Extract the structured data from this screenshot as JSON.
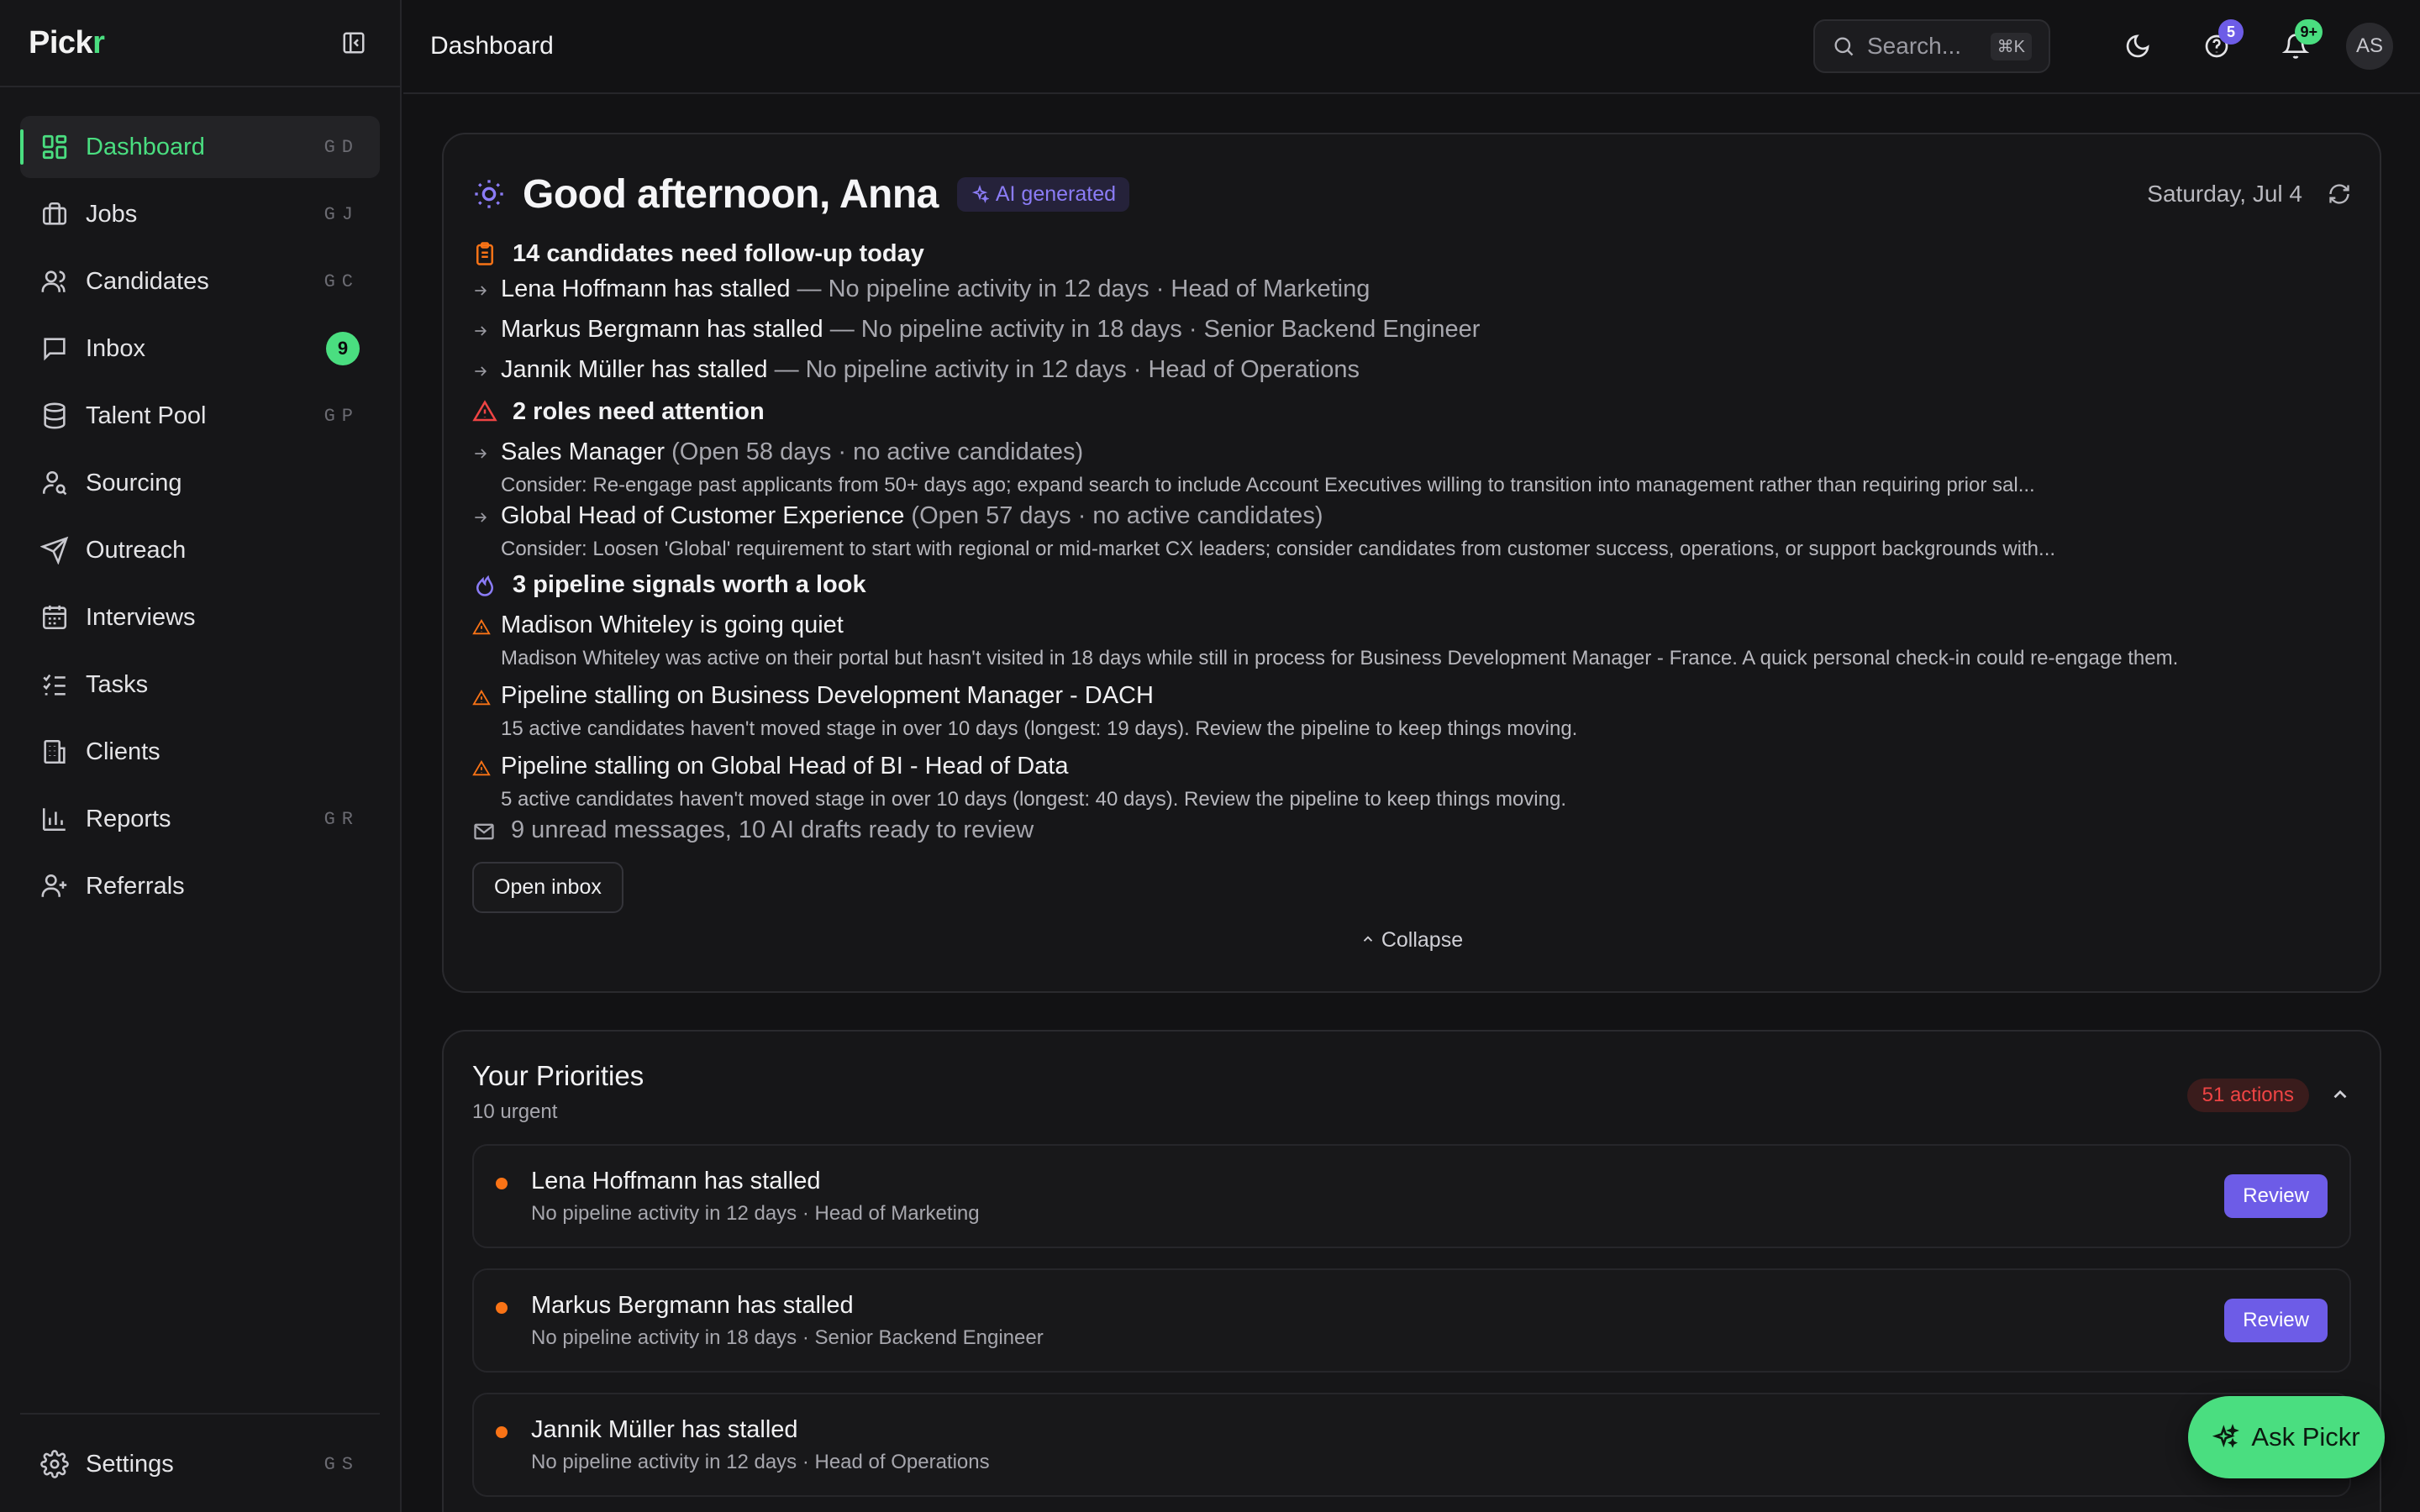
{
  "app": {
    "logo_main": "Pick",
    "logo_accent": "r"
  },
  "sidebar": {
    "items": [
      {
        "label": "Dashboard",
        "shortcut": "GD",
        "icon": "dashboard-icon"
      },
      {
        "label": "Jobs",
        "shortcut": "GJ",
        "icon": "briefcase-icon"
      },
      {
        "label": "Candidates",
        "shortcut": "GC",
        "icon": "users-icon"
      },
      {
        "label": "Inbox",
        "badge": "9",
        "icon": "message-icon"
      },
      {
        "label": "Talent Pool",
        "shortcut": "GP",
        "icon": "database-icon"
      },
      {
        "label": "Sourcing",
        "icon": "user-search-icon"
      },
      {
        "label": "Outreach",
        "icon": "send-icon"
      },
      {
        "label": "Interviews",
        "icon": "calendar-icon"
      },
      {
        "label": "Tasks",
        "icon": "checklist-icon"
      },
      {
        "label": "Clients",
        "icon": "building-icon"
      },
      {
        "label": "Reports",
        "shortcut": "GR",
        "icon": "bar-chart-icon"
      },
      {
        "label": "Referrals",
        "icon": "user-plus-icon"
      }
    ],
    "settings": {
      "label": "Settings",
      "shortcut": "GS",
      "icon": "gear-icon"
    }
  },
  "header": {
    "title": "Dashboard",
    "search_placeholder": "Search...",
    "search_shortcut": "⌘K",
    "help_count": "5",
    "notifications_count": "9+",
    "avatar_initials": "AS"
  },
  "briefing": {
    "greeting": "Good afternoon, Anna",
    "ai_label": "AI generated",
    "date": "Saturday, Jul 4",
    "followup": {
      "heading": "14 candidates need follow-up today",
      "items": [
        {
          "main": "Lena Hoffmann has stalled",
          "detail": " — No pipeline activity in 12 days · Head of Marketing"
        },
        {
          "main": "Markus Bergmann has stalled",
          "detail": " — No pipeline activity in 18 days · Senior Backend Engineer"
        },
        {
          "main": "Jannik Müller has stalled",
          "detail": " — No pipeline activity in 12 days · Head of Operations"
        }
      ]
    },
    "roles": {
      "heading": "2 roles need attention",
      "items": [
        {
          "main": "Sales Manager",
          "detail": " (Open 58 days · no active candidates)",
          "note": "Consider: Re-engage past applicants from 50+ days ago; expand search to include Account Executives willing to transition into management rather than requiring prior sal..."
        },
        {
          "main": "Global Head of Customer Experience",
          "detail": " (Open 57 days · no active candidates)",
          "note": "Consider: Loosen 'Global' requirement to start with regional or mid-market CX leaders; consider candidates from customer success, operations, or support backgrounds with..."
        }
      ]
    },
    "signals": {
      "heading": "3 pipeline signals worth a look",
      "items": [
        {
          "main": "Madison Whiteley is going quiet",
          "note": "Madison Whiteley was active on their portal but hasn't visited in 18 days while still in process for Business Development Manager - France. A quick personal check-in could re-engage them."
        },
        {
          "main": "Pipeline stalling on Business Development Manager - DACH",
          "note": "15 active candidates haven't moved stage in over 10 days (longest: 19 days). Review the pipeline to keep things moving."
        },
        {
          "main": "Pipeline stalling on Global Head of BI - Head of Data",
          "note": "5 active candidates haven't moved stage in over 10 days (longest: 40 days). Review the pipeline to keep things moving."
        }
      ]
    },
    "messages": "9 unread messages, 10 AI drafts ready to review",
    "open_inbox": "Open inbox",
    "collapse": "Collapse"
  },
  "priorities": {
    "title": "Your Priorities",
    "subtitle": "10 urgent",
    "actions": "51 actions",
    "review_label": "Review",
    "items": [
      {
        "name": "Lena Hoffmann has stalled",
        "desc": "No pipeline activity in 12 days · Head of Marketing"
      },
      {
        "name": "Markus Bergmann has stalled",
        "desc": "No pipeline activity in 18 days · Senior Backend Engineer"
      },
      {
        "name": "Jannik Müller has stalled",
        "desc": "No pipeline activity in 12 days · Head of Operations"
      }
    ]
  },
  "ask": {
    "label": "Ask Pickr"
  },
  "colors": {
    "accent_green": "#4ade80",
    "accent_purple": "#6d5ce7",
    "warning_orange": "#f97316",
    "danger_red": "#ef4444"
  }
}
